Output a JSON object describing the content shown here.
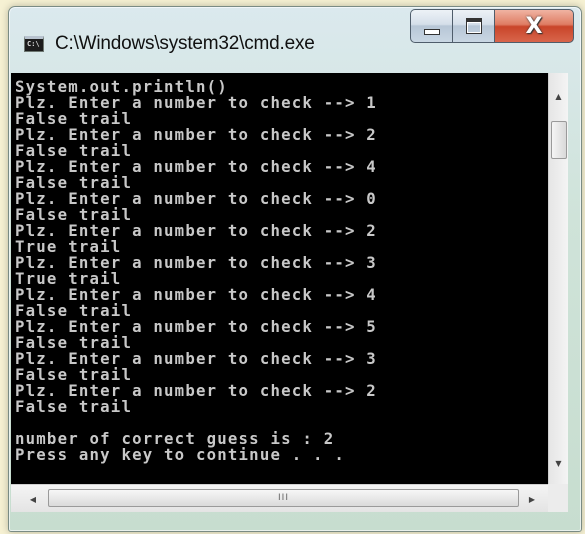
{
  "window": {
    "title": "C:\\Windows\\system32\\cmd.exe",
    "icon_label": "C:\\"
  },
  "console": {
    "lines": [
      "System.out.println()",
      "Plz. Enter a number to check --> 1",
      "False trail",
      "Plz. Enter a number to check --> 2",
      "False trail",
      "Plz. Enter a number to check --> 4",
      "False trail",
      "Plz. Enter a number to check --> 0",
      "False trail",
      "Plz. Enter a number to check --> 2",
      "True trail",
      "Plz. Enter a number to check --> 3",
      "True trail",
      "Plz. Enter a number to check --> 4",
      "False trail",
      "Plz. Enter a number to check --> 5",
      "False trail",
      "Plz. Enter a number to check --> 3",
      "False trail",
      "Plz. Enter a number to check --> 2",
      "False trail",
      "",
      "number of correct guess is : 2",
      "Press any key to continue . . ."
    ]
  },
  "caption_buttons": {
    "close_glyph": "X"
  },
  "scrollbar": {
    "hthumb_grip": "III",
    "up_arrow": "▲",
    "down_arrow": "▼",
    "left_arrow": "◀",
    "right_arrow": "▶"
  }
}
